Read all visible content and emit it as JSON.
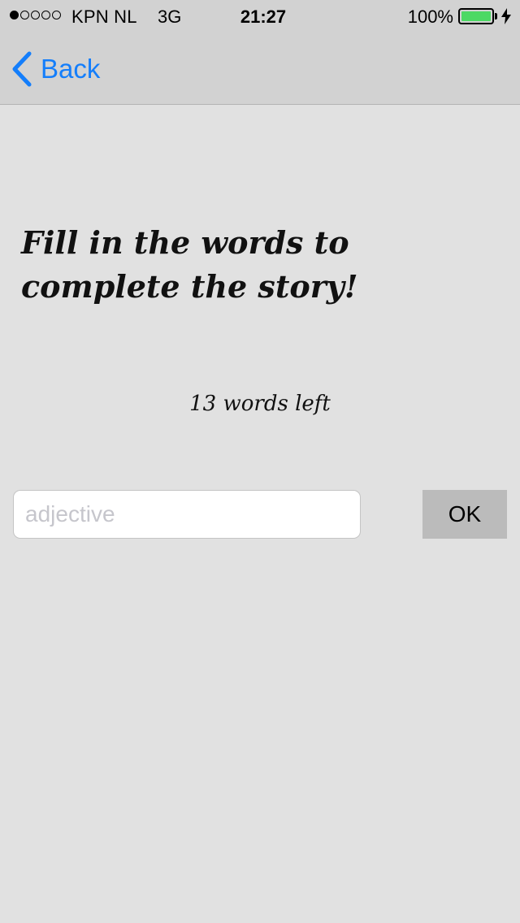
{
  "status_bar": {
    "signal_dots_filled": 1,
    "signal_dots_total": 5,
    "carrier": "KPN NL",
    "network": "3G",
    "time": "21:27",
    "battery_percent": "100%",
    "battery_level": 1.0,
    "battery_color": "#4cd964",
    "charging_icon": "bolt-icon"
  },
  "nav": {
    "back_label": "Back",
    "back_icon": "chevron-left-icon",
    "accent_color": "#147efb"
  },
  "main": {
    "headline": "Fill in the words to complete the story!",
    "words_left": "13 words left",
    "input": {
      "value": "",
      "placeholder": "adjective"
    },
    "ok_label": "OK"
  }
}
